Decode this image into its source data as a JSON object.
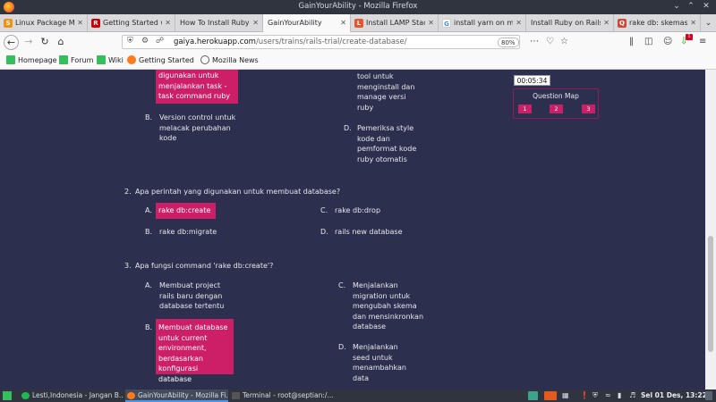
{
  "window": {
    "title": "GainYourAbility - Mozilla Firefox"
  },
  "tabs": [
    {
      "label": "Linux Package M",
      "icon": "tab-favicon-linux-icon",
      "color": "#f29111"
    },
    {
      "label": "Getting Started w",
      "icon": "tab-favicon-rails-icon",
      "color": "#cc0000"
    },
    {
      "label": "How To Install Ruby",
      "icon": "none",
      "color": ""
    },
    {
      "label": "GainYourAbility",
      "icon": "none",
      "color": "",
      "active": true
    },
    {
      "label": "Install LAMP Stac",
      "icon": "tab-favicon-lamp-icon",
      "color": "#e4572e"
    },
    {
      "label": "install yarn on m",
      "icon": "google-icon",
      "color": "#4285f4"
    },
    {
      "label": "Install Ruby on Rails",
      "icon": "none",
      "color": ""
    },
    {
      "label": "rake db: skemas",
      "icon": "tab-favicon-qa-icon",
      "color": "#d14836"
    }
  ],
  "nav": {
    "url_prefix": "gaiya.herokuapp.com",
    "url_path": "/users/trains/rails-trial/create-database/",
    "zoom": "80%",
    "download_badge": "1"
  },
  "bookmarks": [
    {
      "label": "Homepage",
      "color": "#35bf5c"
    },
    {
      "label": "Forum",
      "color": "#35bf5c"
    },
    {
      "label": "Wiki",
      "color": "#35bf5c"
    },
    {
      "label": "Getting Started",
      "color": "#ff7a1a"
    },
    {
      "label": "Mozilla News",
      "color": "#5b5b66"
    }
  ],
  "quiz": {
    "timer": "00:05:34",
    "question_map_title": "Question Map",
    "question_map": [
      "1",
      "2",
      "3"
    ],
    "q1": {
      "opt_a_tail": "digunakan untuk menjalankan task - task command ruby",
      "opt_b": "Version control untuk melacak perubahan kode",
      "opt_c_tail": "tool untuk menginstall dan manage versi ruby",
      "opt_d": "Pemeriksa style kode dan pemformat kode ruby otomatis"
    },
    "q2": {
      "number": "2.",
      "text": "Apa perintah yang digunakan untuk membuat database?",
      "opt_a": "rake db:create",
      "opt_b": "rake db:migrate",
      "opt_c": "rake db:drop",
      "opt_d": "rails new database"
    },
    "q3": {
      "number": "3.",
      "text": "Apa fungsi command 'rake db:create'?",
      "opt_a": "Membuat project rails baru dengan database tertentu",
      "opt_b": "Membuat database untuk current environment, berdasarkan konfigurasi database",
      "opt_c": "Menjalankan migration untuk mengubah skema dan mensinkronkan database",
      "opt_d": "Menjalankan seed untuk menambahkan data"
    },
    "letters": {
      "a": "A.",
      "b": "B.",
      "c": "C.",
      "d": "D."
    }
  },
  "taskbar": {
    "items": [
      {
        "label": "Lesti,Indonesia - Jangan B...",
        "color": "#1db954"
      },
      {
        "label": "GainYourAbility - Mozilla Fi...",
        "color": "#ff7a1a",
        "active": true
      },
      {
        "label": "Terminal - root@septian:/...",
        "color": "#555555"
      }
    ],
    "clock": "Sel 01 Des, 13:22"
  }
}
